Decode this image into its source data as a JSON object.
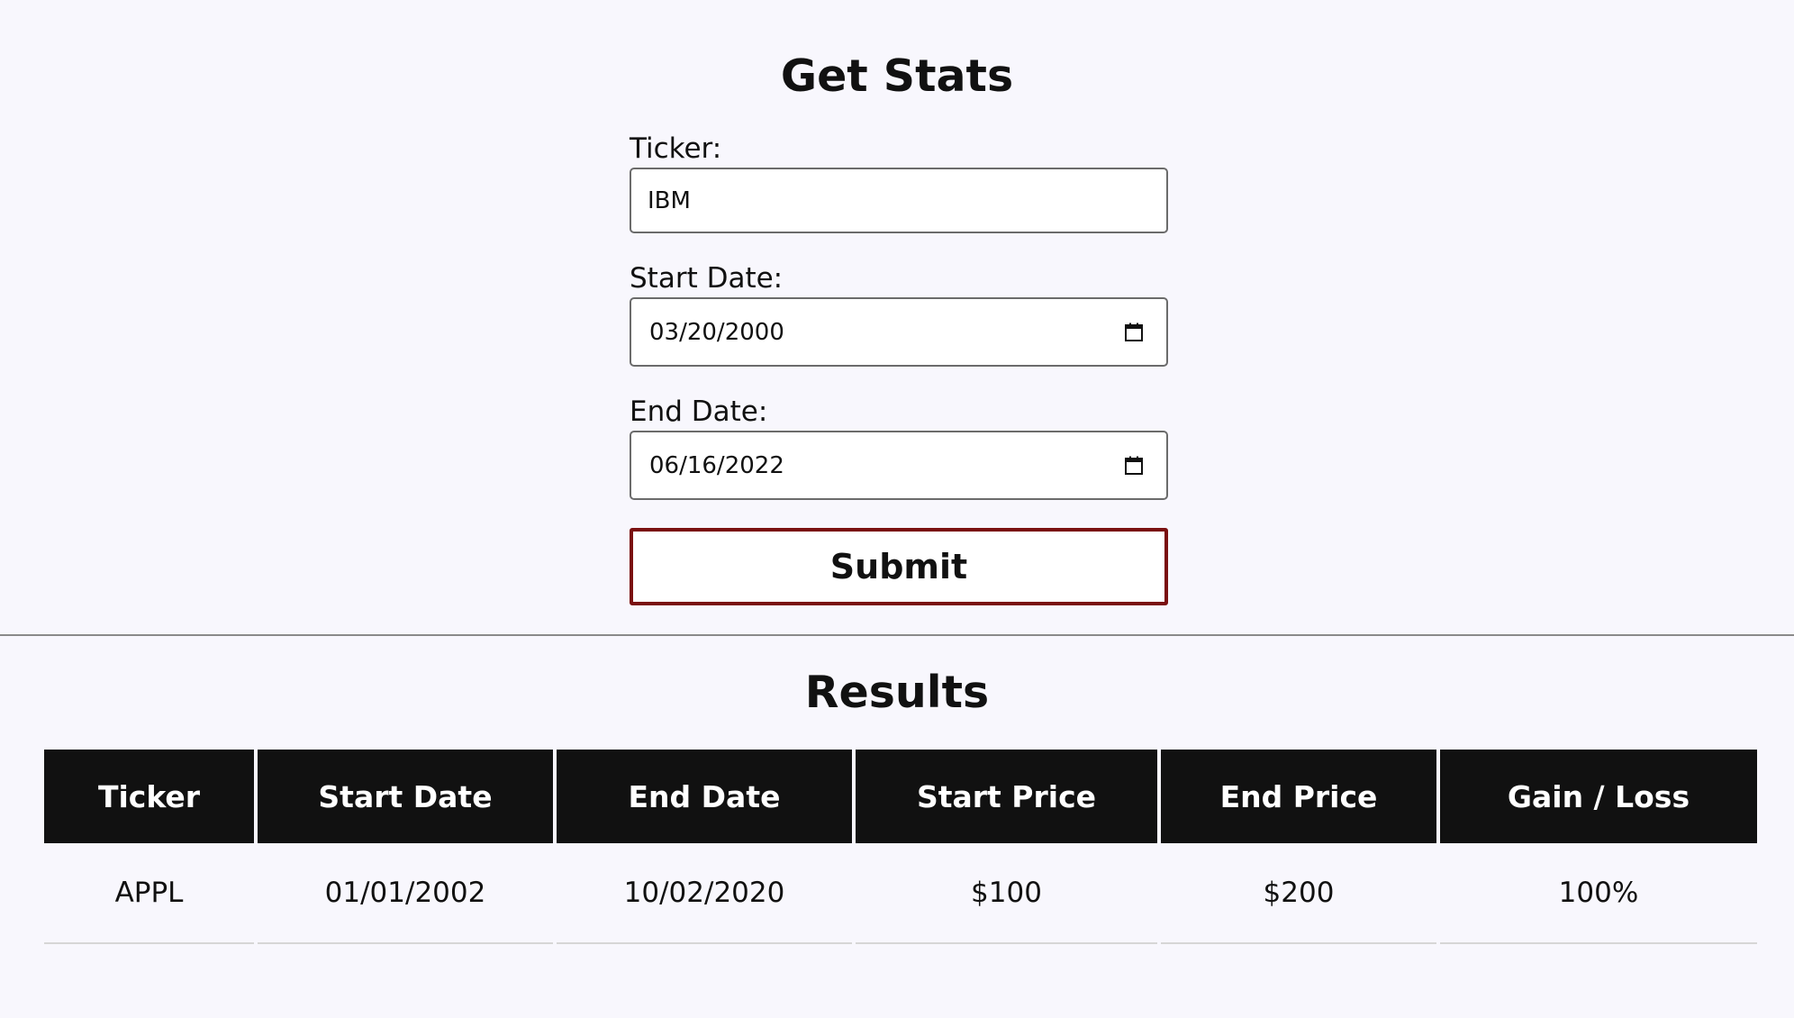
{
  "form": {
    "title": "Get Stats",
    "ticker_label": "Ticker:",
    "ticker_value": "IBM",
    "start_date_label": "Start Date:",
    "start_date_value": "03/20/2000",
    "end_date_label": "End Date:",
    "end_date_value": "06/16/2022",
    "submit_label": "Submit",
    "icons": {
      "date_picker": "calendar-icon"
    },
    "colors": {
      "submit_border": "#7a1010"
    }
  },
  "results": {
    "title": "Results",
    "columns": [
      "Ticker",
      "Start Date",
      "End Date",
      "Start Price",
      "End Price",
      "Gain / Loss"
    ],
    "rows": [
      [
        "APPL",
        "01/01/2002",
        "10/02/2020",
        "$100",
        "$200",
        "100%"
      ]
    ],
    "colors": {
      "header_bg": "#111111",
      "header_text": "#ffffff"
    }
  }
}
